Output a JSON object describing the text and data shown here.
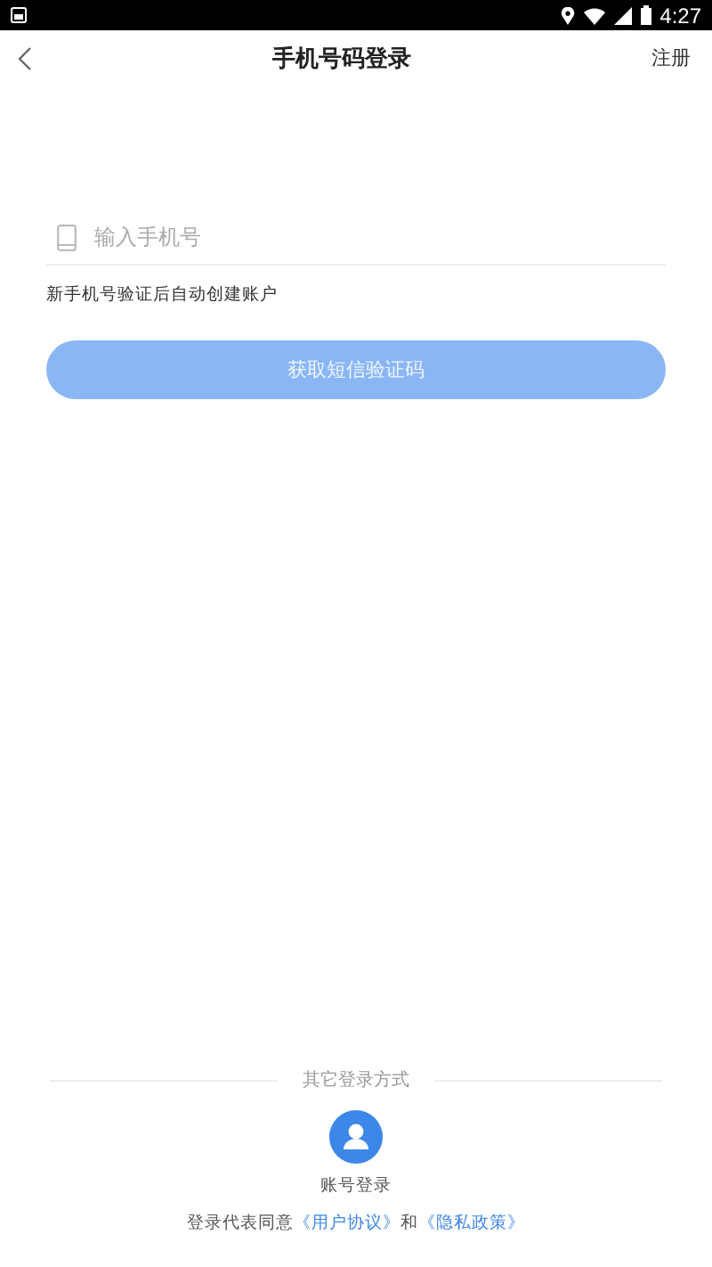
{
  "status_bar": {
    "time": "4:27"
  },
  "nav_bar": {
    "title": "手机号码登录",
    "action": "注册"
  },
  "phone_field": {
    "placeholder": "输入手机号"
  },
  "hint": "新手机号验证后自动创建账户",
  "submit_button": {
    "label": "获取短信验证码",
    "disabled": true
  },
  "other_login": {
    "heading": "其它登录方式",
    "methods": [
      {
        "label": "账号登录"
      }
    ]
  },
  "agreement": {
    "prefix": "登录代表同意",
    "links": [
      "《用户协议》",
      "《隐私政策》"
    ],
    "joiner": "和"
  }
}
